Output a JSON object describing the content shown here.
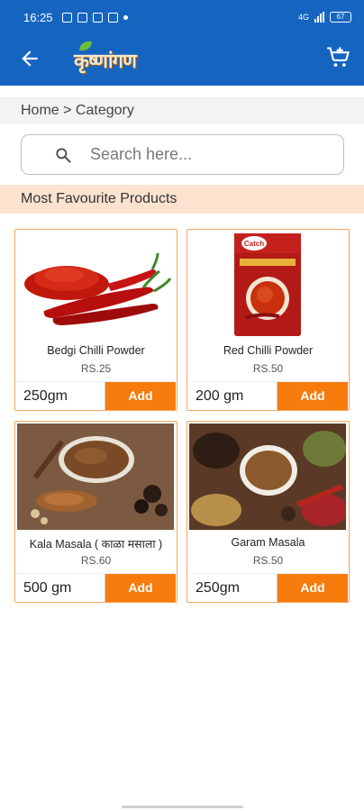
{
  "status_bar": {
    "time": "16:25",
    "network": "4G",
    "battery": "67"
  },
  "app": {
    "logo_text": "कृष्णांगण"
  },
  "breadcrumb": "Home > Category",
  "search": {
    "placeholder": "Search here..."
  },
  "section_title": "Most Favourite Products",
  "products": [
    {
      "name": "Bedgi Chilli Powder",
      "price": "RS.25",
      "quantity": "250gm",
      "add_label": "Add"
    },
    {
      "name": "Red Chilli Powder",
      "price": "RS.50",
      "quantity": "200 gm",
      "add_label": "Add"
    },
    {
      "name": "Kala Masala ( काळा मसाला )",
      "price": "RS.60",
      "quantity": "500 gm",
      "add_label": "Add"
    },
    {
      "name": "Garam Masala",
      "price": "RS.50",
      "quantity": "250gm",
      "add_label": "Add"
    }
  ],
  "packet_brand": "Catch",
  "colors": {
    "primary": "#1565c0",
    "accent": "#f77b0d",
    "card_border": "#f5a65b",
    "section_bg": "#fde3cf"
  }
}
